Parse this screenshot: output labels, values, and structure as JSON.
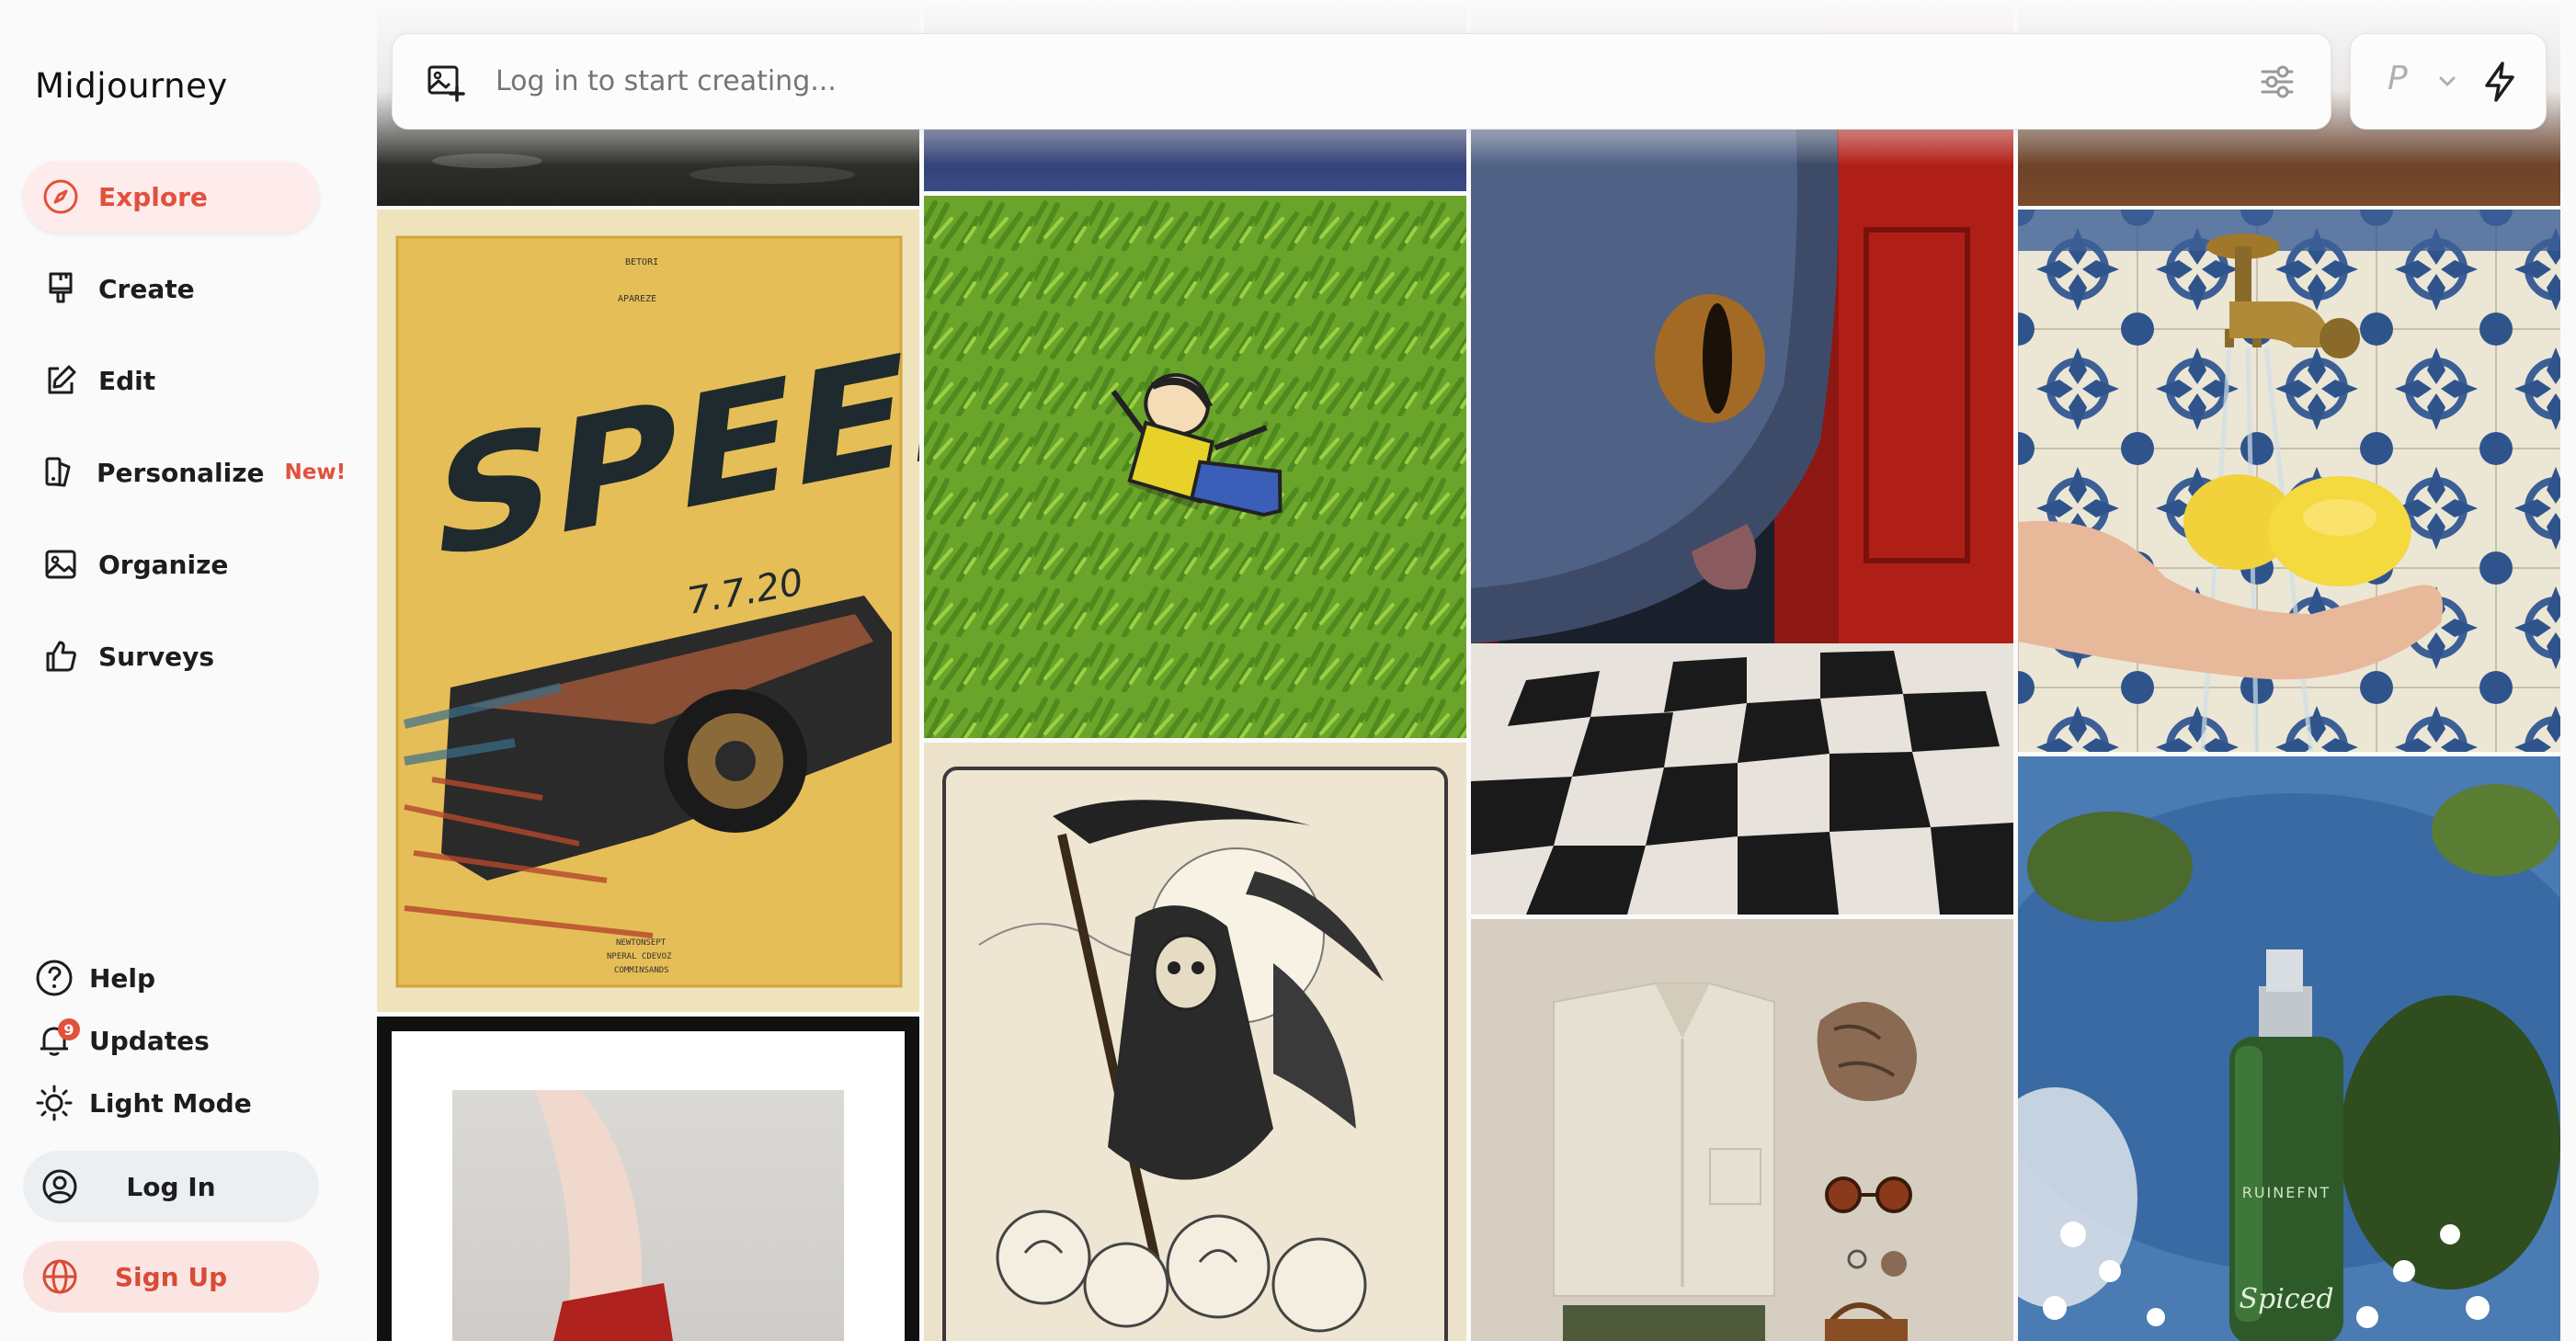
{
  "app": {
    "title": "Midjourney"
  },
  "nav": {
    "items": [
      {
        "label": "Explore",
        "icon": "compass-icon",
        "active": true
      },
      {
        "label": "Create",
        "icon": "brush-icon"
      },
      {
        "label": "Edit",
        "icon": "edit-icon"
      },
      {
        "label": "Personalize",
        "icon": "personalize-icon",
        "tag": "New!"
      },
      {
        "label": "Organize",
        "icon": "image-icon"
      },
      {
        "label": "Surveys",
        "icon": "thumbs-up-icon"
      }
    ]
  },
  "footer": {
    "help": "Help",
    "updates": "Updates",
    "updates_count": "9",
    "light_mode": "Light Mode",
    "login": "Log In",
    "signup": "Sign Up"
  },
  "prompt": {
    "placeholder": "Log in to start creating...",
    "version_label": "P"
  },
  "gallery": {
    "speed_poster": {
      "title": "SPEED",
      "subtitle": "7.7.20"
    },
    "serum": {
      "brand": "RUINEFNT",
      "name": "Spiced"
    }
  },
  "colors": {
    "accent": "#e2513c",
    "accent_bg": "#fdeceb"
  }
}
